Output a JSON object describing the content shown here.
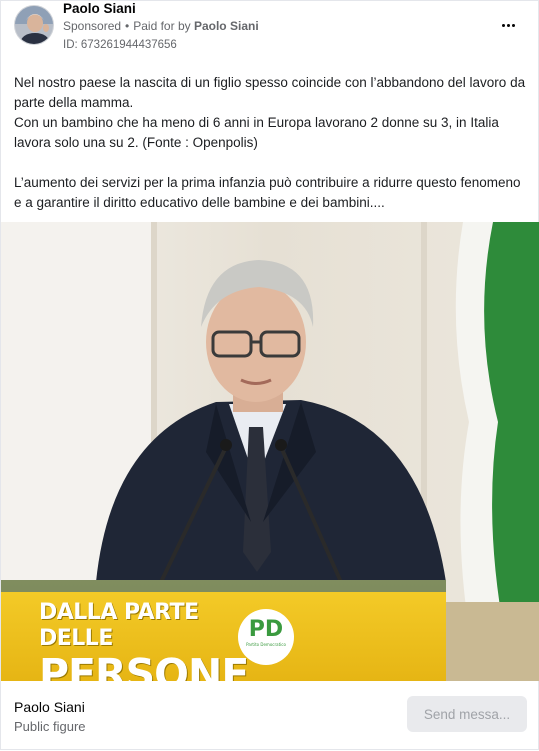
{
  "post": {
    "page_name": "Paolo Siani",
    "sponsored_label": "Sponsored",
    "separator": "•",
    "paid_for_prefix": "Paid for by",
    "paid_for_name": "Paolo Siani",
    "ad_id": "ID: 673261944437656",
    "more_icon": "more-horizontal-icon",
    "text_lines": [
      "Nel nostro paese la nascita di un figlio spesso coincide con l’abbandono del lavoro da parte della mamma.",
      "Con un bambino che ha meno di 6 anni in Europa lavorano 2 donne su 3, in Italia lavora solo una su 2. (Fonte : Openpolis)",
      "L’aumento dei servizi per la prima infanzia può contribuire a ridurre questo fenomeno e a garantire il diritto educativo delle bambine e dei bambini...."
    ]
  },
  "media": {
    "podium_line1": "DALLA PARTE DELLE",
    "podium_line2": "PERSONE",
    "logo_text": "PD",
    "logo_small": "Partito Democratico",
    "colors": {
      "podium_yellow": "#f2c419",
      "logo_green": "#3a9a3f",
      "logo_red": "#d7281f",
      "flag_green": "#2e8b3a"
    }
  },
  "footer": {
    "name": "Paolo Siani",
    "category": "Public figure",
    "send_label": "Send messa..."
  }
}
